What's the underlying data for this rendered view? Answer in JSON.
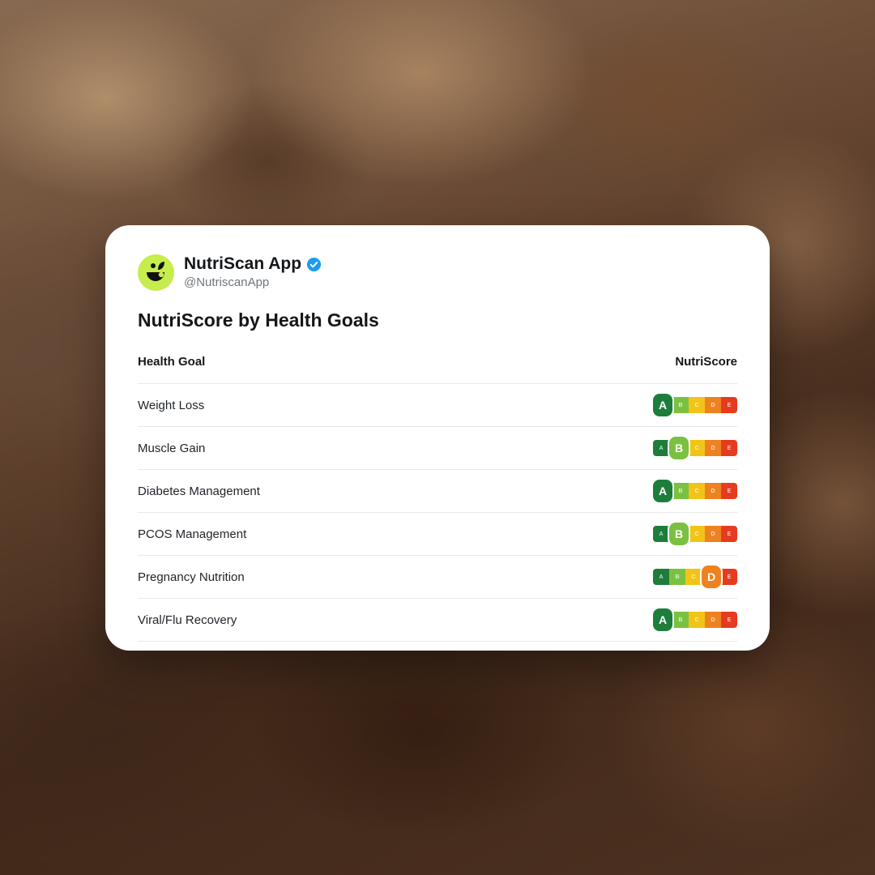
{
  "account": {
    "display_name": "NutriScan App",
    "handle": "@NutriscanApp",
    "verified": true
  },
  "title": "NutriScore by Health Goals",
  "table": {
    "headers": {
      "goal": "Health Goal",
      "score": "NutriScore"
    },
    "grades": [
      "A",
      "B",
      "C",
      "D",
      "E"
    ],
    "grade_colors": [
      "#1e7d3b",
      "#7ac142",
      "#f2c418",
      "#ee8120",
      "#e63b1f"
    ],
    "rows": [
      {
        "goal": "Weight Loss",
        "score": "A"
      },
      {
        "goal": "Muscle Gain",
        "score": "B"
      },
      {
        "goal": "Diabetes Management",
        "score": "A"
      },
      {
        "goal": "PCOS Management",
        "score": "B"
      },
      {
        "goal": "Pregnancy Nutrition",
        "score": "D"
      },
      {
        "goal": "Viral/Flu Recovery",
        "score": "A"
      }
    ]
  },
  "colors": {
    "avatar_bg": "#c6ec4d",
    "verified_badge": "#1d9bf0"
  },
  "icons": {
    "avatar": "nutriscan-logo-icon",
    "verified": "verified-badge-icon"
  }
}
